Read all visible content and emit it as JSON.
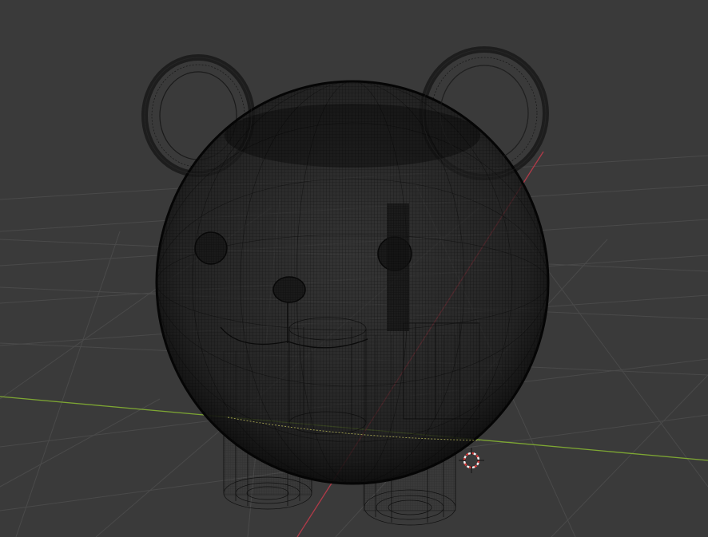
{
  "viewport": {
    "mode": "wireframe",
    "background_color": "#3a3a3a",
    "grid_color": "#4a4a4a",
    "x_axis_color": "#b03a48",
    "y_axis_color": "#7ea733",
    "mesh_color": "#000000",
    "cursor_color": "#d43b3b"
  },
  "scene": {
    "objects": [
      {
        "name": "bear-head",
        "type": "uv-sphere"
      },
      {
        "name": "left-ear",
        "type": "torus"
      },
      {
        "name": "right-ear",
        "type": "torus"
      },
      {
        "name": "left-eye",
        "type": "sphere"
      },
      {
        "name": "right-eye",
        "type": "sphere"
      },
      {
        "name": "nose",
        "type": "sphere"
      },
      {
        "name": "front-left-leg",
        "type": "cylinder"
      },
      {
        "name": "front-right-leg",
        "type": "cylinder"
      }
    ]
  }
}
